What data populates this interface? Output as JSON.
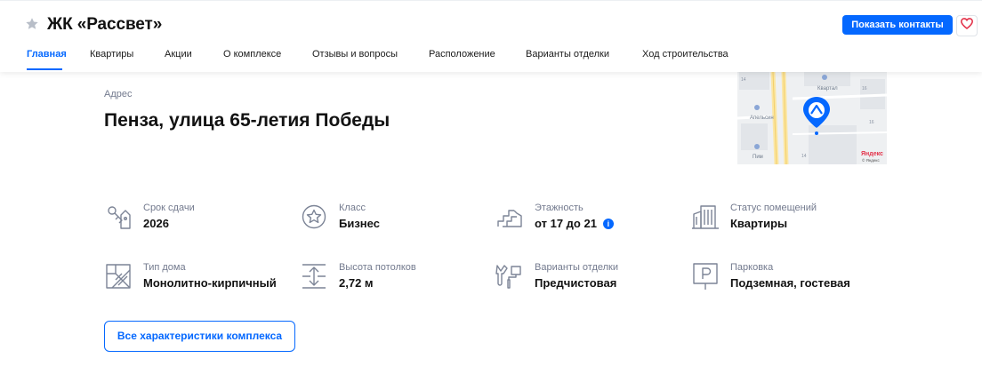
{
  "header": {
    "title": "ЖК «Рассвет»",
    "show_contacts_label": "Показать контакты",
    "favorite_icon": "star-icon",
    "heart_icon": "heart-icon"
  },
  "tabs": [
    {
      "label": "Главная",
      "active": true
    },
    {
      "label": "Квартиры"
    },
    {
      "label": "Акции"
    },
    {
      "label": "О комплексе"
    },
    {
      "label": "Отзывы и вопросы"
    },
    {
      "label": "Расположение"
    },
    {
      "label": "Варианты отделки"
    },
    {
      "label": "Ход строительства"
    }
  ],
  "address": {
    "label": "Адрес",
    "value": "Пенза, улица 65-летия Победы"
  },
  "map": {
    "labels": [
      "Квартал",
      "Апельсин",
      "Пим",
      "16",
      "16",
      "14",
      "14"
    ],
    "brand": "Яндекс",
    "copyright": "© Яндекс"
  },
  "features": [
    {
      "label": "Срок сдачи",
      "value": "2026",
      "icon": "key-icon"
    },
    {
      "label": "Класс",
      "value": "Бизнес",
      "icon": "star-circle-icon"
    },
    {
      "label": "Этажность",
      "value": "от 17 до 21",
      "icon": "stairs-icon",
      "info": "i"
    },
    {
      "label": "Статус помещений",
      "value": "Квартиры",
      "icon": "buildings-icon"
    },
    {
      "label": "Тип дома",
      "value": "Монолитно-кирпичный",
      "icon": "wall-icon"
    },
    {
      "label": "Высота потолков",
      "value": "2,72 м",
      "icon": "ceiling-height-icon"
    },
    {
      "label": "Варианты отделки",
      "value": "Предчистовая",
      "icon": "tools-icon"
    },
    {
      "label": "Парковка",
      "value": "Подземная, гостевая",
      "icon": "parking-icon"
    }
  ],
  "all_characteristics_label": "Все характеристики комплекса",
  "colors": {
    "accent": "#0468ff",
    "muted_text": "#737a8e",
    "heart": "#e3334b"
  }
}
